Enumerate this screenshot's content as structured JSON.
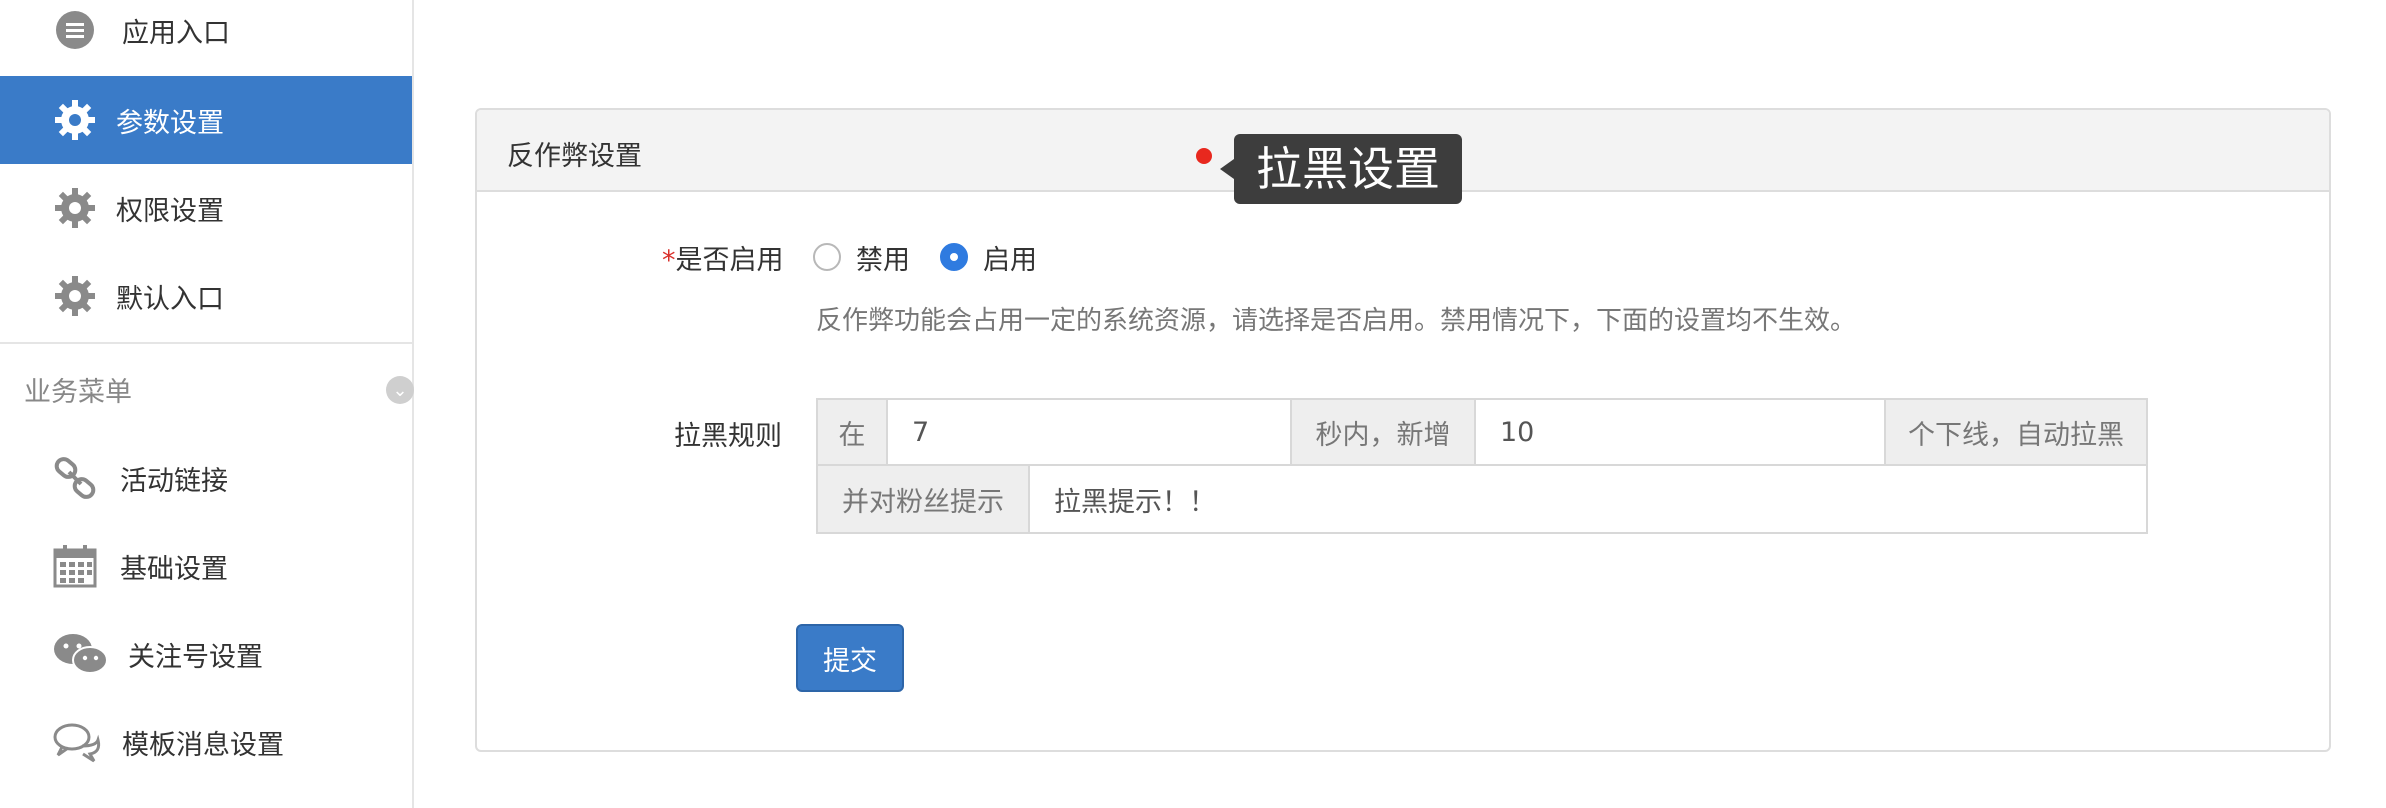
{
  "sidebar": {
    "items": [
      {
        "label": "应用入口",
        "icon": "message-icon"
      },
      {
        "label": "参数设置",
        "icon": "gear-icon",
        "active": true
      },
      {
        "label": "权限设置",
        "icon": "gear-icon"
      },
      {
        "label": "默认入口",
        "icon": "gear-icon"
      }
    ],
    "section_title": "业务菜单",
    "section_items": [
      {
        "label": "活动链接",
        "icon": "link-icon"
      },
      {
        "label": "基础设置",
        "icon": "calendar-icon"
      },
      {
        "label": "关注号设置",
        "icon": "wechat-icon"
      },
      {
        "label": "模板消息设置",
        "icon": "chat-bubbles-icon"
      }
    ]
  },
  "panel": {
    "title": "反作弊设置",
    "tooltip": "拉黑设置",
    "enable": {
      "required_mark": "*",
      "label": "是否启用",
      "options": [
        "禁用",
        "启用"
      ],
      "selected": "启用",
      "help": "反作弊功能会占用一定的系统资源，请选择是否启用。禁用情况下，下面的设置均不生效。"
    },
    "blacklist": {
      "label": "拉黑规则",
      "prefix_in": "在",
      "seconds_value": "7",
      "mid_text": "秒内，新增",
      "count_value": "10",
      "suffix_text": "个下线，自动拉黑",
      "notice_label": "并对粉丝提示",
      "notice_value": "拉黑提示！！"
    },
    "submit_label": "提交"
  },
  "colors": {
    "accent": "#3a7bc8",
    "marker": "#e8281e",
    "tooltip_bg": "#3d3d3d"
  }
}
